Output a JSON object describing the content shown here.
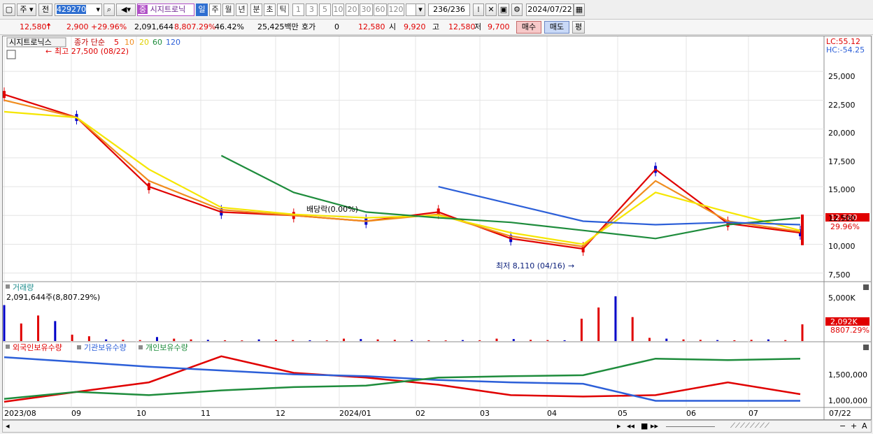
{
  "toolbar": {
    "market_tab": "주",
    "period_tab": "전",
    "code": "429270",
    "stock_badge": "중",
    "stock_name": "시지트로닉",
    "timeframes": [
      "일",
      "주",
      "월",
      "년",
      "분",
      "초",
      "틱"
    ],
    "intervals": [
      "1",
      "3",
      "5",
      "10",
      "20",
      "30",
      "60",
      "120"
    ],
    "count": "236",
    "count_total": "/236",
    "date": "2024/07/22"
  },
  "quote": {
    "price": "12,580",
    "change": "2,900",
    "change_pct": "+29.96%",
    "volume": "2,091,644",
    "volume_ratio": "8,807.29%",
    "turnover": "46.42%",
    "amount": "25,425백만",
    "hoga_label": "호가",
    "hoga": "0",
    "hoga_price": "12,580",
    "open_label": "시",
    "open": "9,920",
    "high_label": "고",
    "high": "12,580",
    "low_label": "저",
    "low": "9,700",
    "buy_label": "매수",
    "sell_label": "매도",
    "eval_label": "평"
  },
  "price_panel": {
    "name_tag": "시지트로닉스",
    "ma_legend": "종가 단순",
    "ma_periods": [
      "5",
      "10",
      "20",
      "60",
      "120"
    ],
    "ma_colors": [
      "#e00000",
      "#f08c1e",
      "#f5e600",
      "#1e8c3c",
      "#2c5fd8"
    ],
    "lc_label": "LC:55.12",
    "hc_label": "HC:-54.25",
    "high_note": "최고 27,500 (08/22)",
    "low_note": "최저 8,110 (04/16)",
    "dividend_note": "배당락(0.00%)",
    "current_price_label": "12,580",
    "current_pct_label": "29.96%",
    "y_ticks": [
      "25,000",
      "22,500",
      "20,000",
      "17,500",
      "15,000",
      "12,500",
      "10,000",
      "7,500"
    ]
  },
  "volume_panel": {
    "title": "거래량",
    "info": "2,091,644주(8,807.29%)",
    "y_ticks": [
      "5,000K",
      "2,500K"
    ],
    "current_label": "2,092K",
    "current_pct": "8807.29%"
  },
  "holding_panel": {
    "legend": [
      "외국인보유수량",
      "기관보유수량",
      "개인보유수량"
    ],
    "colors": [
      "#e00000",
      "#2c5fd8",
      "#1e8c3c"
    ],
    "y_ticks": [
      "1,500,000",
      "1,000,000"
    ]
  },
  "x_axis": {
    "labels": [
      "2023/08",
      "09",
      "10",
      "11",
      "12",
      "2024/01",
      "02",
      "03",
      "04",
      "05",
      "06",
      "07",
      "07/22"
    ]
  },
  "chart_data": [
    {
      "type": "line",
      "title": "종가 단순",
      "description_source": "daily candlestick price panel",
      "ylim": [
        7000,
        27800
      ],
      "x": [
        "2023/08",
        "09",
        "10",
        "11",
        "12",
        "2024/01",
        "02",
        "03",
        "04",
        "05",
        "06",
        "07"
      ],
      "series": [
        {
          "name": "5",
          "values": [
            23000,
            21000,
            15000,
            12800,
            12500,
            12000,
            12800,
            10500,
            9600,
            16500,
            11800,
            11000
          ]
        },
        {
          "name": "10",
          "values": [
            22500,
            21000,
            15500,
            13000,
            12500,
            12000,
            12600,
            10700,
            9800,
            15500,
            12000,
            11100
          ]
        },
        {
          "name": "20",
          "values": [
            21500,
            21000,
            16500,
            13200,
            12600,
            12300,
            12500,
            11000,
            10000,
            14500,
            12800,
            11200
          ]
        },
        {
          "name": "60",
          "values": [
            null,
            null,
            null,
            17700,
            14500,
            12800,
            12300,
            11900,
            11200,
            10500,
            11700,
            12300
          ]
        },
        {
          "name": "120",
          "values": [
            null,
            null,
            null,
            null,
            null,
            null,
            15000,
            13500,
            12000,
            11700,
            11900,
            11700
          ]
        }
      ],
      "annotations": [
        {
          "text": "최고 27,500 (08/22)",
          "value": 27500
        },
        {
          "text": "최저 8,110 (04/16)",
          "value": 8110
        },
        {
          "text": "배당락(0.00%)"
        }
      ],
      "current": 12580
    },
    {
      "type": "bar",
      "title": "거래량",
      "ylim": [
        0,
        7000
      ],
      "unit": "K",
      "values": [
        4500,
        2200,
        3200,
        2500,
        800,
        600,
        200,
        150,
        120,
        500,
        300,
        200,
        150,
        100,
        80,
        200,
        150,
        120,
        100,
        80,
        300,
        250,
        200,
        150,
        120,
        100,
        80,
        120,
        100,
        300,
        250,
        150,
        120,
        100,
        2800,
        4200,
        5600,
        3000,
        400,
        300,
        200,
        150,
        120,
        100,
        150,
        200,
        120,
        2092
      ],
      "current": 2092
    },
    {
      "type": "line",
      "title": "보유수량",
      "x": [
        "2023/08",
        "09",
        "10",
        "11",
        "12",
        "2024/01",
        "02",
        "03",
        "04",
        "05",
        "06",
        "07"
      ],
      "series": [
        {
          "name": "외국인보유수량",
          "values": [
            940000,
            1150000,
            1350000,
            1900000,
            1550000,
            1450000,
            1300000,
            1080000,
            1050000,
            1080000,
            1350000,
            1100000
          ]
        },
        {
          "name": "기관보유수량",
          "values": [
            1880000,
            1780000,
            1680000,
            1600000,
            1520000,
            1480000,
            1400000,
            1350000,
            1320000,
            960000,
            960000,
            960000
          ]
        },
        {
          "name": "개인보유수량",
          "values": [
            1000000,
            1150000,
            1080000,
            1180000,
            1250000,
            1280000,
            1450000,
            1480000,
            1500000,
            1850000,
            1820000,
            1850000
          ]
        }
      ]
    }
  ]
}
